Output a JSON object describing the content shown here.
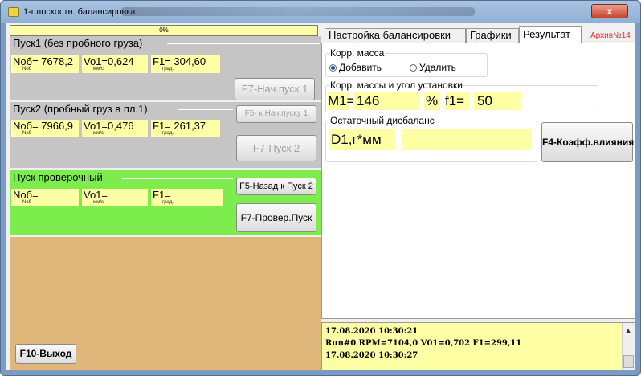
{
  "window": {
    "title": "1-плоскостн. балансировка",
    "close_label": "x"
  },
  "progress": {
    "label": "0%",
    "value": 0
  },
  "run1": {
    "title": "Пуск1 (без пробного груза)",
    "nob": "Nоб= 7678,2",
    "nob_unit": "Nоб",
    "vo": "Vo1=0,624",
    "vo_unit": "мм/с",
    "f": "F1= 304,60",
    "f_unit": "град.",
    "start_button": "F7-Нач.пуск 1"
  },
  "run2": {
    "title": "Пуск2 (пробный груз в пл.1)",
    "nob": "Nоб= 7966,9",
    "nob_unit": "Nоб",
    "vo": "Vo1=0,476",
    "vo_unit": "мм/с",
    "f": "F1= 261,37",
    "f_unit": "град.",
    "back_button": "F5- к Нач.пуску 1",
    "start_button": "F7-Пуск 2"
  },
  "check_run": {
    "title": "Пуск проверочный",
    "nob": "Nоб=",
    "nob_unit": "Nоб",
    "vo": "Vo1=",
    "vo_unit": "мм/с",
    "f": "F1=",
    "f_unit": "град.",
    "back_button": "F5-Назад к Пуск 2",
    "start_button": "F7-Провер.Пуск"
  },
  "exit_button": "F10-Выход",
  "tabs": [
    {
      "label": "Настройка балансировки",
      "active": false
    },
    {
      "label": "Графики",
      "active": false
    },
    {
      "label": "Результат",
      "active": true
    }
  ],
  "archive_label": "Архив№14",
  "result": {
    "mass_group_label": "Корр. масса",
    "radio_add": "Добавить",
    "radio_remove": "Удалить",
    "selected": "add",
    "mass_angle_group_label": "Корр. массы и угол установки",
    "m1_label": "M1=",
    "m1_value": "146",
    "percent_label": "%",
    "f1_label": "f1=",
    "f1_value": "50",
    "residual_group_label": "Остаточный дисбаланс",
    "residual_label": "D1,г*мм",
    "residual_value": "",
    "coef_button": "F4-Коэфф.влияния"
  },
  "log": [
    "17.08.2020 10:30:21",
    "Run#0 RPM=7104,0 V01=0,702 F1=299,11",
    "17.08.2020 10:30:27"
  ],
  "colors": {
    "value_bg": "#ffffa6",
    "check_section": "#7ded4e",
    "empty_area": "#dfb77a",
    "archive": "#e03030"
  }
}
